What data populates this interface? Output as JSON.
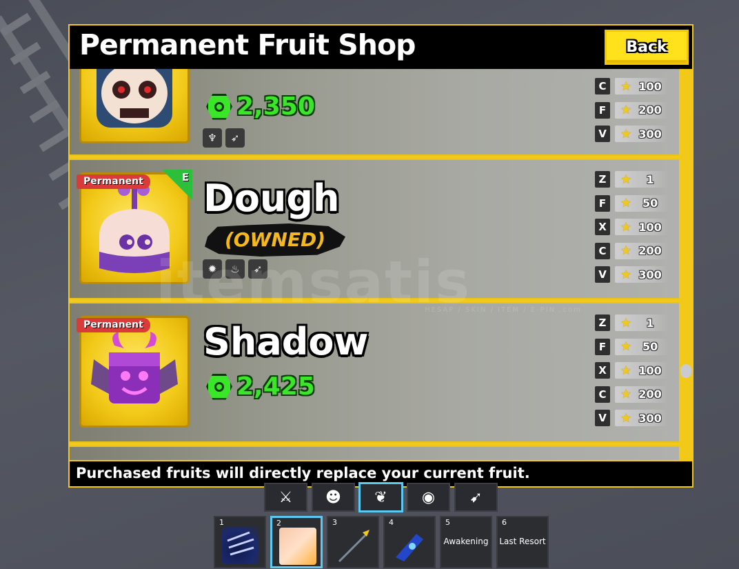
{
  "shop": {
    "title": "Permanent Fruit Shop",
    "back_label": "Back",
    "footer_note": "Purchased fruits will directly replace your current fruit."
  },
  "fruits": [
    {
      "name": "",
      "price": "2,350",
      "badge": "",
      "moves": [
        "dragon-move-icon",
        "tornado-move-icon"
      ],
      "skills": [
        {
          "key": "C",
          "mastery": "100"
        },
        {
          "key": "F",
          "mastery": "200"
        },
        {
          "key": "V",
          "mastery": "300"
        }
      ]
    },
    {
      "name": "Dough",
      "status": "(OWNED)",
      "badge": "Permanent",
      "rarity": "E",
      "moves": [
        "gear-move-icon",
        "fire-move-icon",
        "tornado-move-icon"
      ],
      "skills": [
        {
          "key": "Z",
          "mastery": "1"
        },
        {
          "key": "F",
          "mastery": "50"
        },
        {
          "key": "X",
          "mastery": "100"
        },
        {
          "key": "C",
          "mastery": "200"
        },
        {
          "key": "V",
          "mastery": "300"
        }
      ]
    },
    {
      "name": "Shadow",
      "price": "2,425",
      "badge": "Permanent",
      "skills": [
        {
          "key": "Z",
          "mastery": "1"
        },
        {
          "key": "F",
          "mastery": "50"
        },
        {
          "key": "X",
          "mastery": "100"
        },
        {
          "key": "C",
          "mastery": "200"
        },
        {
          "key": "V",
          "mastery": "300"
        }
      ]
    }
  ],
  "watermark": {
    "text": "itemsatis",
    "sub": "HESAP / SKIN / ITEM / E-PIN .com"
  },
  "tabs": [
    "sword-tab-icon",
    "mask-tab-icon",
    "fruit-tab-icon",
    "eye-tab-icon",
    "wing-tab-icon"
  ],
  "hotbar": [
    {
      "num": "1",
      "label": "",
      "art": "claw-weapon-icon"
    },
    {
      "num": "2",
      "label": "",
      "art": "dough-fruit-icon"
    },
    {
      "num": "3",
      "label": "",
      "art": "spear-icon"
    },
    {
      "num": "4",
      "label": "",
      "art": "gun-icon"
    },
    {
      "num": "5",
      "label": "Awakening"
    },
    {
      "num": "6",
      "label": "Last Resort"
    }
  ],
  "colors": {
    "accent_yellow": "#f2c918",
    "robux_green": "#39e628",
    "owned_gold": "#f3b81d",
    "badge_red": "#d93a3a",
    "rarity_green": "#2cbf3c",
    "active_blue": "#5bc9f2"
  }
}
